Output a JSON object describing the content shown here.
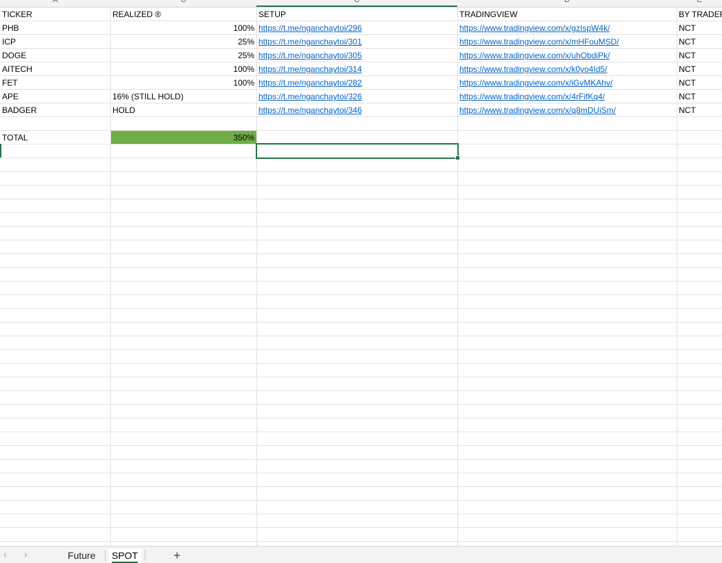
{
  "columns": [
    "A",
    "B",
    "C",
    "D",
    "E"
  ],
  "selected_column": "C",
  "header_row": {
    "ticker": "TICKER",
    "realized": "REALIZED ®",
    "setup": "SETUP",
    "tradingview": "TRADINGVIEW",
    "by_trader": "BY TRADER"
  },
  "rows": [
    {
      "ticker": "PHB",
      "realized": "100%",
      "setup": "https://t.me/nganchaytoi/296",
      "tradingview": "https://www.tradingview.com/x/gzIspW4k/",
      "trader": "NCT"
    },
    {
      "ticker": "ICP",
      "realized": "25%",
      "setup": "https://t.me/nganchaytoi/301",
      "tradingview": "https://www.tradingview.com/x/mHFouMSD/",
      "trader": "NCT"
    },
    {
      "ticker": "DOGE",
      "realized": "25%",
      "setup": "https://t.me/nganchaytoi/305",
      "tradingview": "https://www.tradingview.com/x/uhObdiPk/",
      "trader": "NCT"
    },
    {
      "ticker": "AITECH",
      "realized": "100%",
      "setup": "https://t.me/nganchaytoi/314",
      "tradingview": "https://www.tradingview.com/x/k0yo4Id5/",
      "trader": "NCT"
    },
    {
      "ticker": "FET",
      "realized": "100%",
      "setup": "https://t.me/nganchaytoi/282",
      "tradingview": "https://www.tradingview.com/x/iGvMKAhv/",
      "trader": "NCT"
    },
    {
      "ticker": "APE",
      "realized": "16% (STILL HOLD)",
      "setup": "https://t.me/nganchaytoi/326",
      "tradingview": "https://www.tradingview.com/x/4rFifKq4/",
      "trader": "NCT"
    },
    {
      "ticker": "BADGER",
      "realized": "HOLD",
      "setup": "https://t.me/nganchaytoi/346",
      "tradingview": "https://www.tradingview.com/x/q8mDUiSm/",
      "trader": "NCT"
    }
  ],
  "total": {
    "label": "TOTAL",
    "value": "350%",
    "fill_color": "#70ad47"
  },
  "sheet_tabs": [
    {
      "label": "Future",
      "active": false
    },
    {
      "label": "SPOT",
      "active": true
    }
  ],
  "add_sheet_label": "+",
  "accent_color": "#217346",
  "link_color": "#0563c1"
}
